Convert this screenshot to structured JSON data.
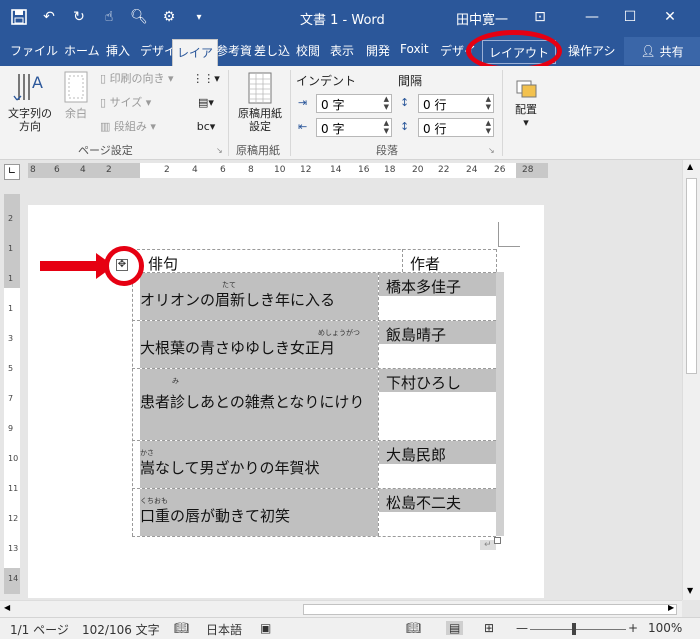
{
  "window": {
    "title": "文書 1  -  Word",
    "user": "田中寛一"
  },
  "tabs": [
    "ファイル",
    "ホーム",
    "挿入",
    "デザイ",
    "レイア",
    "参考資",
    "差し込",
    "校閲",
    "表示",
    "開発",
    "Foxit",
    "デザイ",
    "レイアウト",
    "操作アシ"
  ],
  "share_label": "共有",
  "ribbon": {
    "text_direction": "文字列の\n方向",
    "margins": "余白",
    "print_orientation": "印刷の向き",
    "size": "サイズ",
    "columns": "段組み",
    "page_setup_group": "ページ設定",
    "manuscript_paper": "原稿用紙\n設定",
    "manuscript_group": "原稿用紙",
    "indent_label": "インデント",
    "spacing_label": "間隔",
    "indent_left": "0 字",
    "indent_right": "0 字",
    "spacing_before": "0 行",
    "spacing_after": "0 行",
    "paragraph_group": "段落",
    "arrange": "配置"
  },
  "ruler": {
    "h_ticks": [
      "8",
      "6",
      "4",
      "2",
      "2",
      "4",
      "6",
      "8",
      "10",
      "12",
      "14",
      "16",
      "18",
      "20",
      "22",
      "24",
      "26",
      "28"
    ],
    "v_ticks": [
      "2",
      "1",
      "1",
      "1",
      "3",
      "5",
      "7",
      "9",
      "10",
      "11",
      "12",
      "13",
      "14"
    ]
  },
  "table": {
    "headers": [
      "俳句",
      "作者"
    ],
    "rows": [
      {
        "haiku": "オリオンの眉新しき年に入る",
        "furigana": "たて",
        "author": "橋本多佳子"
      },
      {
        "haiku": "大根葉の青さゆゆしき女正月",
        "furigana": "めしょうがつ",
        "author": "飯島晴子"
      },
      {
        "haiku": "患者診しあとの雑煮となりにけり",
        "furigana": "み",
        "author": "下村ひろし"
      },
      {
        "haiku": "嵩なして男ざかりの年賀状",
        "furigana": "かさ",
        "author": "大島民郎"
      },
      {
        "haiku": "口重の唇が動きて初笑",
        "furigana": "くちおも",
        "author": "松島不二夫"
      }
    ]
  },
  "status": {
    "page": "1/1 ページ",
    "words": "102/106 文字",
    "language": "日本語",
    "zoom": "100%"
  }
}
